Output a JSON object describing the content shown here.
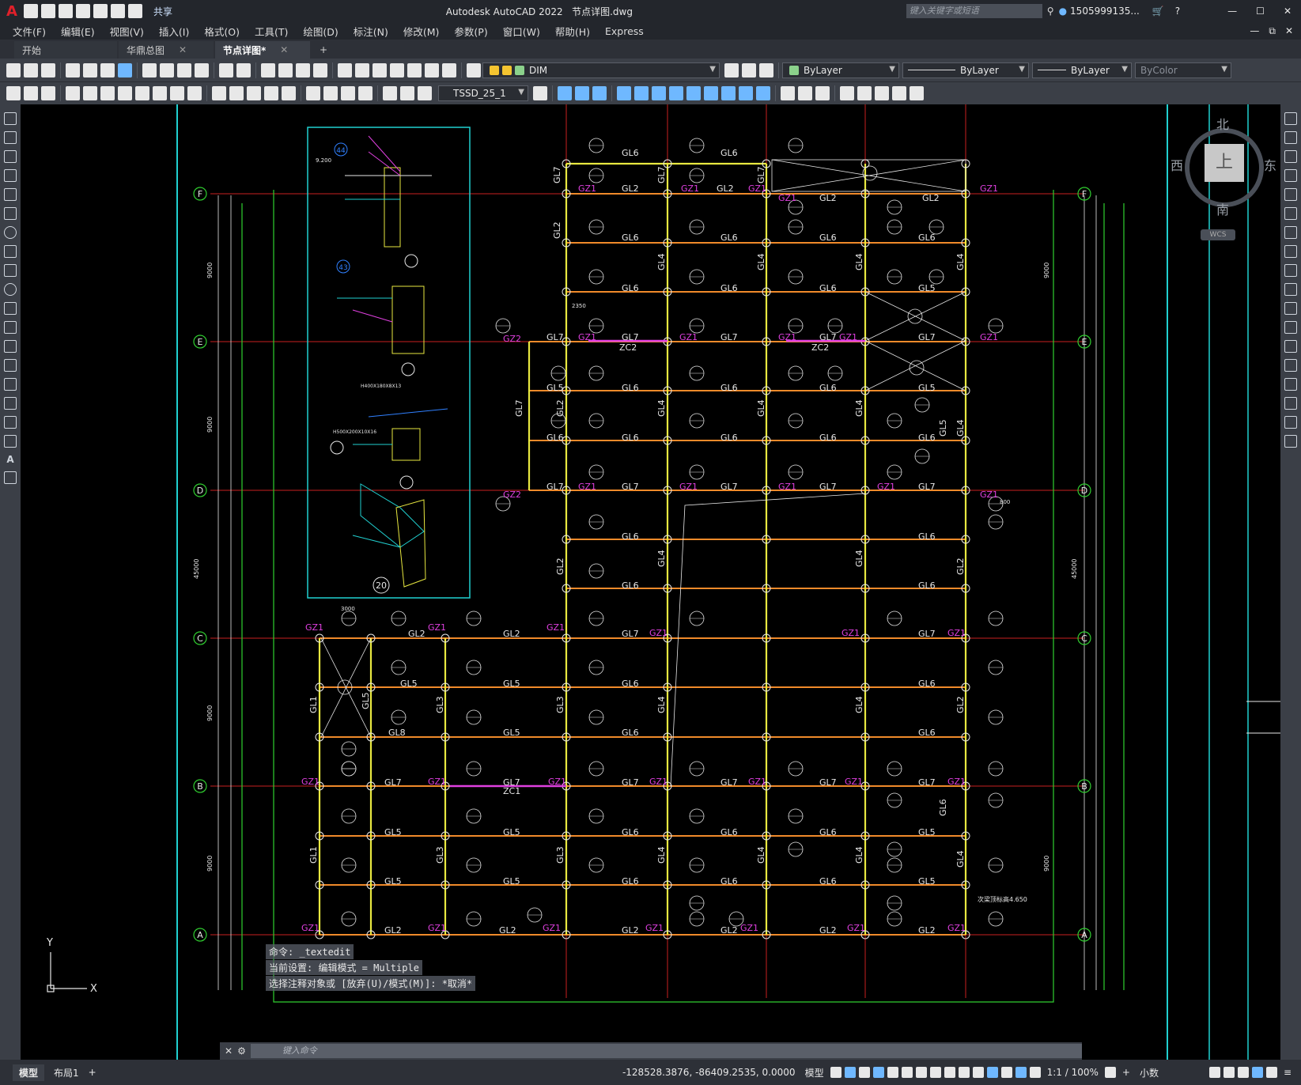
{
  "app": {
    "title": "Autodesk AutoCAD 2022",
    "filename": "节点详图.dwg",
    "quick_share": "共享"
  },
  "search": {
    "placeholder": "键入关键字或短语",
    "user": "1505999135...",
    "help": "?"
  },
  "menu": [
    "文件(F)",
    "编辑(E)",
    "视图(V)",
    "插入(I)",
    "格式(O)",
    "工具(T)",
    "绘图(D)",
    "标注(N)",
    "修改(M)",
    "参数(P)",
    "窗口(W)",
    "帮助(H)",
    "Express"
  ],
  "tabs": [
    {
      "label": "开始"
    },
    {
      "label": "华鼎总图"
    },
    {
      "label": "节点详图*"
    }
  ],
  "toolbar": {
    "layer": "DIM",
    "color": "ByLayer",
    "linetype": "ByLayer",
    "lineweight": "ByLayer",
    "plotstyle": "ByColor",
    "tssd": "TSSD_25_1"
  },
  "viewcube": {
    "north": "北",
    "south": "南",
    "east": "东",
    "west": "西",
    "top": "上",
    "wcs": "WCS"
  },
  "axes": {
    "rows": [
      "F",
      "E",
      "D",
      "C",
      "B",
      "A"
    ],
    "ucs_y": "Y"
  },
  "beams": {
    "gl6": "GL6",
    "gl7": "GL7",
    "gl2": "GL2",
    "gl5": "GL5",
    "gl4": "GL4",
    "gl3": "GL3",
    "gl1": "GL1",
    "gl8": "GL8",
    "gz1": "GZ1",
    "gz2": "GZ2",
    "zc1": "ZC1",
    "zc2": "ZC2"
  },
  "dims": {
    "d9000": "9000",
    "d3000": "3000",
    "d45000": "45000",
    "d3000b": "3000",
    "d2350": "2350",
    "d800": "800"
  },
  "labels": {
    "detail20": "20",
    "detail43": "43",
    "detail44": "44",
    "elev": "9.200",
    "sec": "H400X180X8X13",
    "sec2": "H500X200X10X16",
    "mark": "次梁顶标高4.650"
  },
  "command": {
    "line1": "命令: _textedit",
    "line2": "当前设置: 编辑模式 = Multiple",
    "line3": "选择注释对象或 [放弃(U)/模式(M)]: *取消*",
    "prompt": "键入命令"
  },
  "layout_tabs": [
    {
      "label": "模型"
    },
    {
      "label": "布局1"
    }
  ],
  "status": {
    "coords": "-128528.3876, -86409.2535, 0.0000",
    "model": "模型",
    "scale": "1:1 / 100%",
    "units": "小数"
  },
  "colors": {
    "bg": "#000000",
    "beam": "#f08a2a",
    "column": "#e8e840",
    "axis": "#d02020",
    "green": "#30d030",
    "cyan": "#20d0d0",
    "magenta": "#e040e0"
  }
}
